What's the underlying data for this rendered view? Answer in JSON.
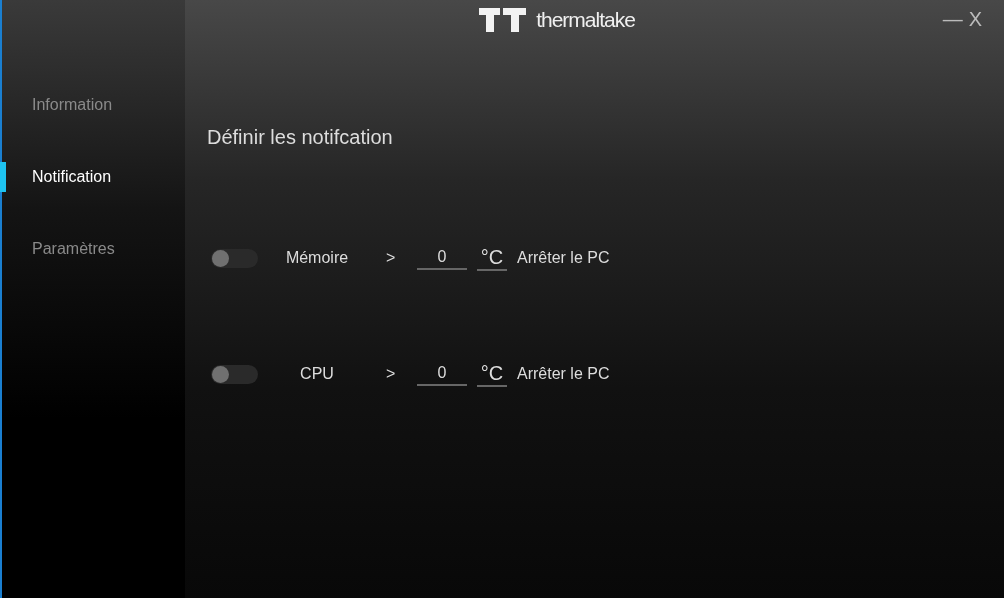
{
  "window": {
    "brand": "thermaltake",
    "controls": [
      "—",
      "X"
    ]
  },
  "sidebar": {
    "items": [
      {
        "label": "Information",
        "selected": false
      },
      {
        "label": "Notification",
        "selected": true
      },
      {
        "label": "Paramètres",
        "selected": false
      }
    ]
  },
  "section_title": "Définir les notifcation",
  "rules": [
    {
      "on": false,
      "label": "Mémoire",
      "operator": ">",
      "value": "0",
      "unit": "°C",
      "action": "Arrêter le PC"
    },
    {
      "on": false,
      "label": "CPU",
      "operator": ">",
      "value": "0",
      "unit": "°C",
      "action": "Arrêter le PC"
    }
  ]
}
